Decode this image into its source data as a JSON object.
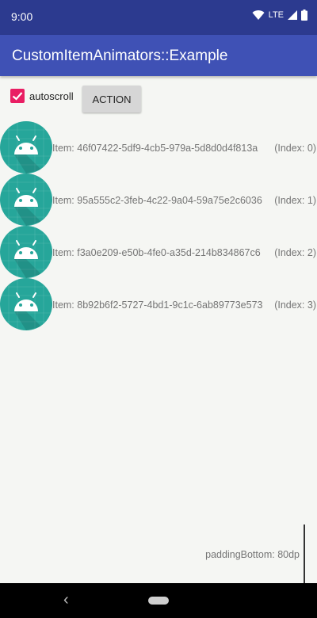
{
  "status_bar": {
    "time": "9:00",
    "network_label": "LTE",
    "icons": [
      "wifi-icon",
      "cellular-signal-icon",
      "battery-icon"
    ]
  },
  "app_bar": {
    "title": "CustomItemAnimators::Example"
  },
  "controls": {
    "autoscroll_label": "autoscroll",
    "autoscroll_checked": true,
    "action_label": "ACTION"
  },
  "items": [
    {
      "text": "Item: 46f07422-5df9-4cb5-979a-5d8d0d4f813a",
      "index": "(Index: 0)"
    },
    {
      "text": "Item: 95a555c2-3feb-4c22-9a04-59a75e2c6036",
      "index": "(Index: 1)"
    },
    {
      "text": "Item: f3a0e209-e50b-4fe0-a35d-214b834867c6",
      "index": "(Index: 2)"
    },
    {
      "text": "Item: 8b92b6f2-5727-4bd1-9c1c-6ab89773e573",
      "index": "(Index: 3)"
    }
  ],
  "padding_note": "paddingBottom: 80dp",
  "nav_bar": {
    "back": "‹"
  },
  "colors": {
    "status_bar": "#2c3a8f",
    "app_bar": "#3f51b5",
    "checkbox": "#e91e63",
    "avatar_bg": "#26a69a",
    "android_head": "#ffffff"
  }
}
